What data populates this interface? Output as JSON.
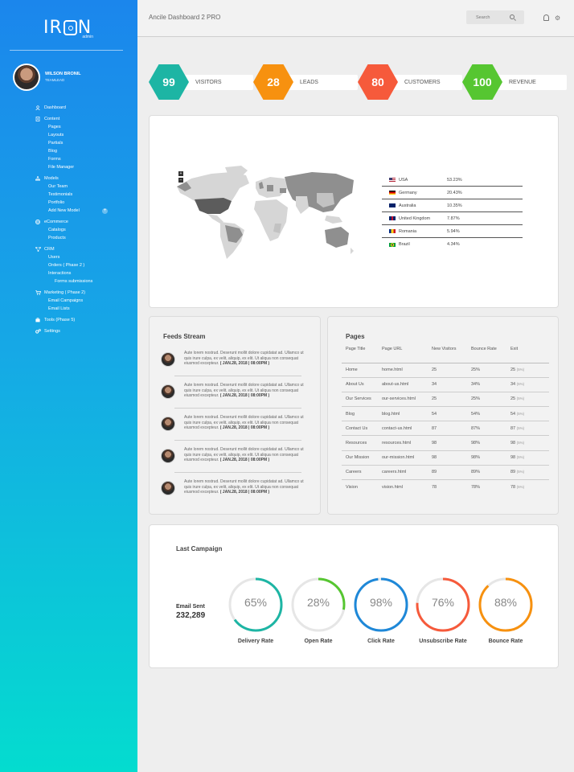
{
  "brand": {
    "name": "IRON",
    "sub": "admin"
  },
  "profile": {
    "name": "WILSON BRONIL",
    "role": "TEAMLEAD"
  },
  "nav": {
    "dashboard": "Dashboard",
    "content": "Content",
    "content_items": [
      "Pages",
      "Layouts",
      "Partials",
      "Blog",
      "Forms",
      "File Manager"
    ],
    "models": "Models",
    "models_items": [
      "Our Team",
      "Testimonials",
      "Portfolio",
      "Add New Model"
    ],
    "ecommerce": "eCommerce",
    "ecommerce_items": [
      "Catalogs",
      "Products"
    ],
    "crm": "CRM",
    "crm_items": [
      "Users",
      "Orders ( Phase 2 )",
      "Interactions",
      "Forms submissions"
    ],
    "marketing": "Marketing ( Phase 2)",
    "marketing_items": [
      "Email Campaigns",
      "Email Lists"
    ],
    "tools": "Tools (Phase 5)",
    "settings": "Settings"
  },
  "topbar": {
    "title": "Ancile Dashboard 2 PRO",
    "search_placeholder": "Search"
  },
  "stats": [
    {
      "value": "99",
      "label": "VISITORS",
      "color": "#1db5a4"
    },
    {
      "value": "28",
      "label": "LEADS",
      "color": "#f7910f"
    },
    {
      "value": "80",
      "label": "CUSTOMERS",
      "color": "#f65a3b"
    },
    {
      "value": "100",
      "label": "REVENUE",
      "color": "#56c631"
    }
  ],
  "map": {
    "countries": [
      {
        "name": "USA",
        "value": "53.23%",
        "flag": "us"
      },
      {
        "name": "Germany",
        "value": "20.43%",
        "flag": "de"
      },
      {
        "name": "Australia",
        "value": "10.35%",
        "flag": "au"
      },
      {
        "name": "United Kingdom",
        "value": "7.87%",
        "flag": "gb"
      },
      {
        "name": "Romania",
        "value": "5.94%",
        "flag": "ro"
      },
      {
        "name": "Brazil",
        "value": "4.34%",
        "flag": "br"
      }
    ]
  },
  "feeds": {
    "title": "Feeds Stream",
    "text": "Aute lorem nostrud. Deserunt mollit dolore cupidatat ad. Ullamco ut quis irure culpa, ex velit, aliquip, ex elit. Ut aliqua non consequat eiusmod excepteur.",
    "date": "( JAN.28, 2018 | 08:00PM )"
  },
  "pages": {
    "title": "Pages",
    "headers": [
      "Page Title",
      "Page URL",
      "New Visitors",
      "Bounce Rate",
      "Exit"
    ],
    "rows": [
      [
        "Home",
        "home.html",
        "25",
        "25%",
        "25",
        "(5%)"
      ],
      [
        "About Us",
        "about-us.html",
        "34",
        "34%",
        "34",
        "(5%)"
      ],
      [
        "Our Services",
        "our-services.html",
        "25",
        "25%",
        "25",
        "(5%)"
      ],
      [
        "Blog",
        "blog.html",
        "54",
        "54%",
        "54",
        "(5%)"
      ],
      [
        "Contact Us",
        "contact-us.html",
        "87",
        "87%",
        "87",
        "(5%)"
      ],
      [
        "Resources",
        "resources.html",
        "98",
        "98%",
        "98",
        "(5%)"
      ],
      [
        "Our Mission",
        "our-mission.html",
        "98",
        "98%",
        "98",
        "(5%)"
      ],
      [
        "Careers",
        "careers.html",
        "89",
        "89%",
        "89",
        "(5%)"
      ],
      [
        "Vision",
        "vision.html",
        "78",
        "78%",
        "78",
        "(5%)"
      ]
    ]
  },
  "campaign": {
    "title": "Last Campaign",
    "email_label": "Email Sent",
    "email_value": "232,289",
    "rings": [
      {
        "value": "65%",
        "fraction": 0.65,
        "label": "Delivery Rate",
        "color": "#1db5a4"
      },
      {
        "value": "28%",
        "fraction": 0.28,
        "label": "Open Rate",
        "color": "#56c631"
      },
      {
        "value": "98%",
        "fraction": 0.98,
        "label": "Click Rate",
        "color": "#1e88d8"
      },
      {
        "value": "76%",
        "fraction": 0.76,
        "label": "Unsubscribe Rate",
        "color": "#f65a3b"
      },
      {
        "value": "88%",
        "fraction": 0.88,
        "label": "Bounce Rate",
        "color": "#f7910f"
      }
    ]
  }
}
